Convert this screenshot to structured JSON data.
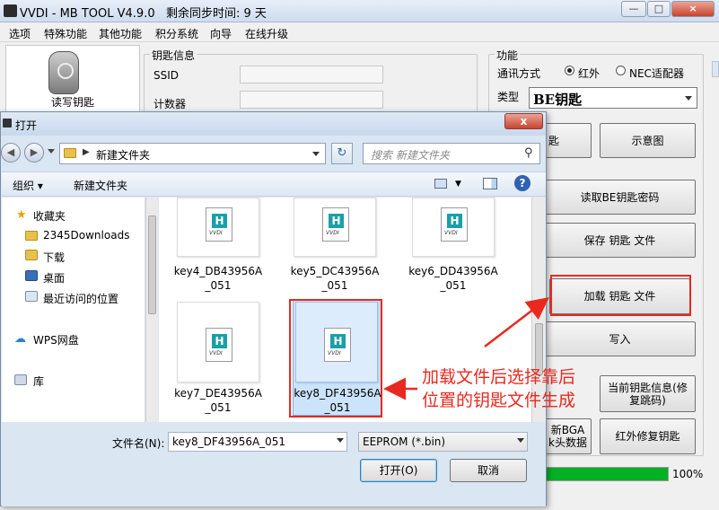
{
  "app": {
    "title": "VVDI - MB TOOL V4.9.0",
    "remaining_sync": "剩余同步时间: 9 天",
    "menu": [
      "选项",
      "特殊功能",
      "其他功能",
      "积分系统",
      "向导",
      "在线升级"
    ]
  },
  "left_panel": {
    "read_write_key": "读写钥匙"
  },
  "key_info": {
    "caption": "钥匙信息",
    "ssid_label": "SSID",
    "counter_label": "计数器",
    "ssid_value": "",
    "counter_value": ""
  },
  "function": {
    "caption": "功能",
    "comm_mode_label": "通讯方式",
    "ir_option": "红外",
    "nec_option": "NEC适配器",
    "type_label": "类型",
    "type_value": "BE钥匙",
    "btn_partial_key": "匙",
    "btn_diagram": "示意图",
    "btn_read_be_password": "读取BE钥匙密码",
    "btn_save_key_file": "保存 钥匙 文件",
    "btn_load_key_file": "加载 钥匙 文件",
    "btn_write": "写入",
    "btn_current_key_info": "当前钥匙信息(修复跳码)",
    "btn_bga_line1": "新BGA",
    "btn_bga_line2": "k头数据",
    "btn_ir_repair": "红外修复钥匙",
    "progress_label": "100%",
    "progress_value": 1.0
  },
  "dialog": {
    "title": "打开",
    "close": "x",
    "address": "新建文件夹",
    "search_placeholder": "搜索 新建文件夹",
    "toolbar_organize": "组织",
    "toolbar_new_folder": "新建文件夹",
    "nav": {
      "favorites": "收藏夹",
      "downloads2345": "2345Downloads",
      "downloads": "下载",
      "desktop": "桌面",
      "recent": "最近访问的位置",
      "wps": "WPS网盘",
      "library": "库"
    },
    "files": [
      {
        "line1": "key4_DB43956A",
        "line2": "_051"
      },
      {
        "line1": "key5_DC43956A",
        "line2": "_051"
      },
      {
        "line1": "key6_DD43956A",
        "line2": "_051"
      },
      {
        "line1": "key7_DE43956A",
        "line2": "_051"
      },
      {
        "line1": "key8_DF43956A",
        "line2": "_051"
      }
    ],
    "filename_label": "文件名(N):",
    "filename_value": "key8_DF43956A_051",
    "filetype_value": "EEPROM (*.bin)",
    "open_button": "打开(O)",
    "cancel_button": "取消"
  },
  "annotation": {
    "line1": "加载文件后选择靠后",
    "line2": "位置的钥匙文件生成",
    "color": "#e8291f"
  }
}
